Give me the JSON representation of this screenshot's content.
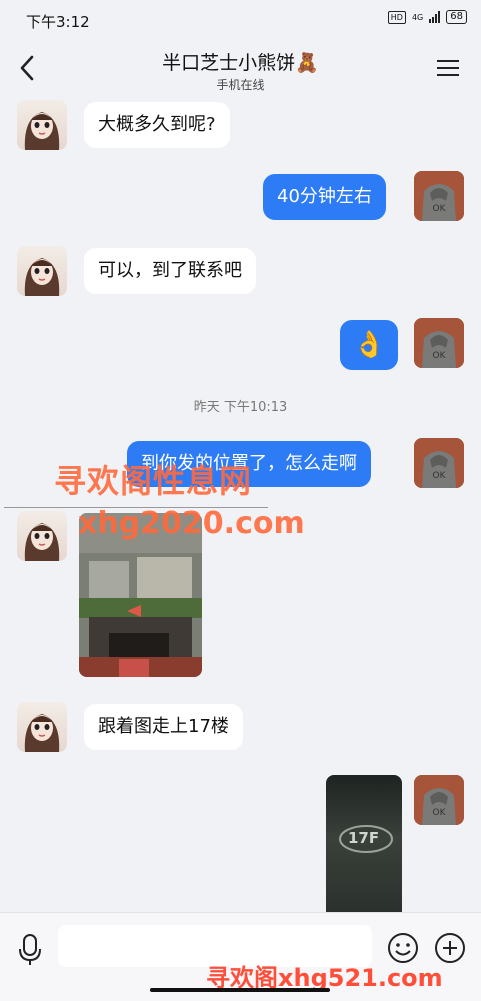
{
  "status": {
    "time": "下午3:12",
    "hd": "HD",
    "network": "4G",
    "battery": "68"
  },
  "header": {
    "title": "半口芝士小熊饼🧸",
    "subtitle": "手机在线"
  },
  "messages": [
    {
      "side": "left",
      "text": "大概多久到呢?"
    },
    {
      "side": "right",
      "text": "40分钟左右"
    },
    {
      "side": "left",
      "text": "可以，到了联系吧"
    },
    {
      "side": "right",
      "text": "👌"
    },
    {
      "side": "right",
      "text": "到你发的位置了，怎么走啊"
    },
    {
      "side": "left",
      "text": "跟着图走上17楼"
    }
  ],
  "timestamp": "昨天 下午10:13",
  "watermarks": {
    "site_name": "寻欢阁性息网",
    "site_url": "xhg2020.com",
    "bottom": "寻欢阁xhg521.com"
  },
  "photo2_label": "17F",
  "colors": {
    "accent": "#2d7cf6",
    "watermark": "#ff6a3d"
  }
}
